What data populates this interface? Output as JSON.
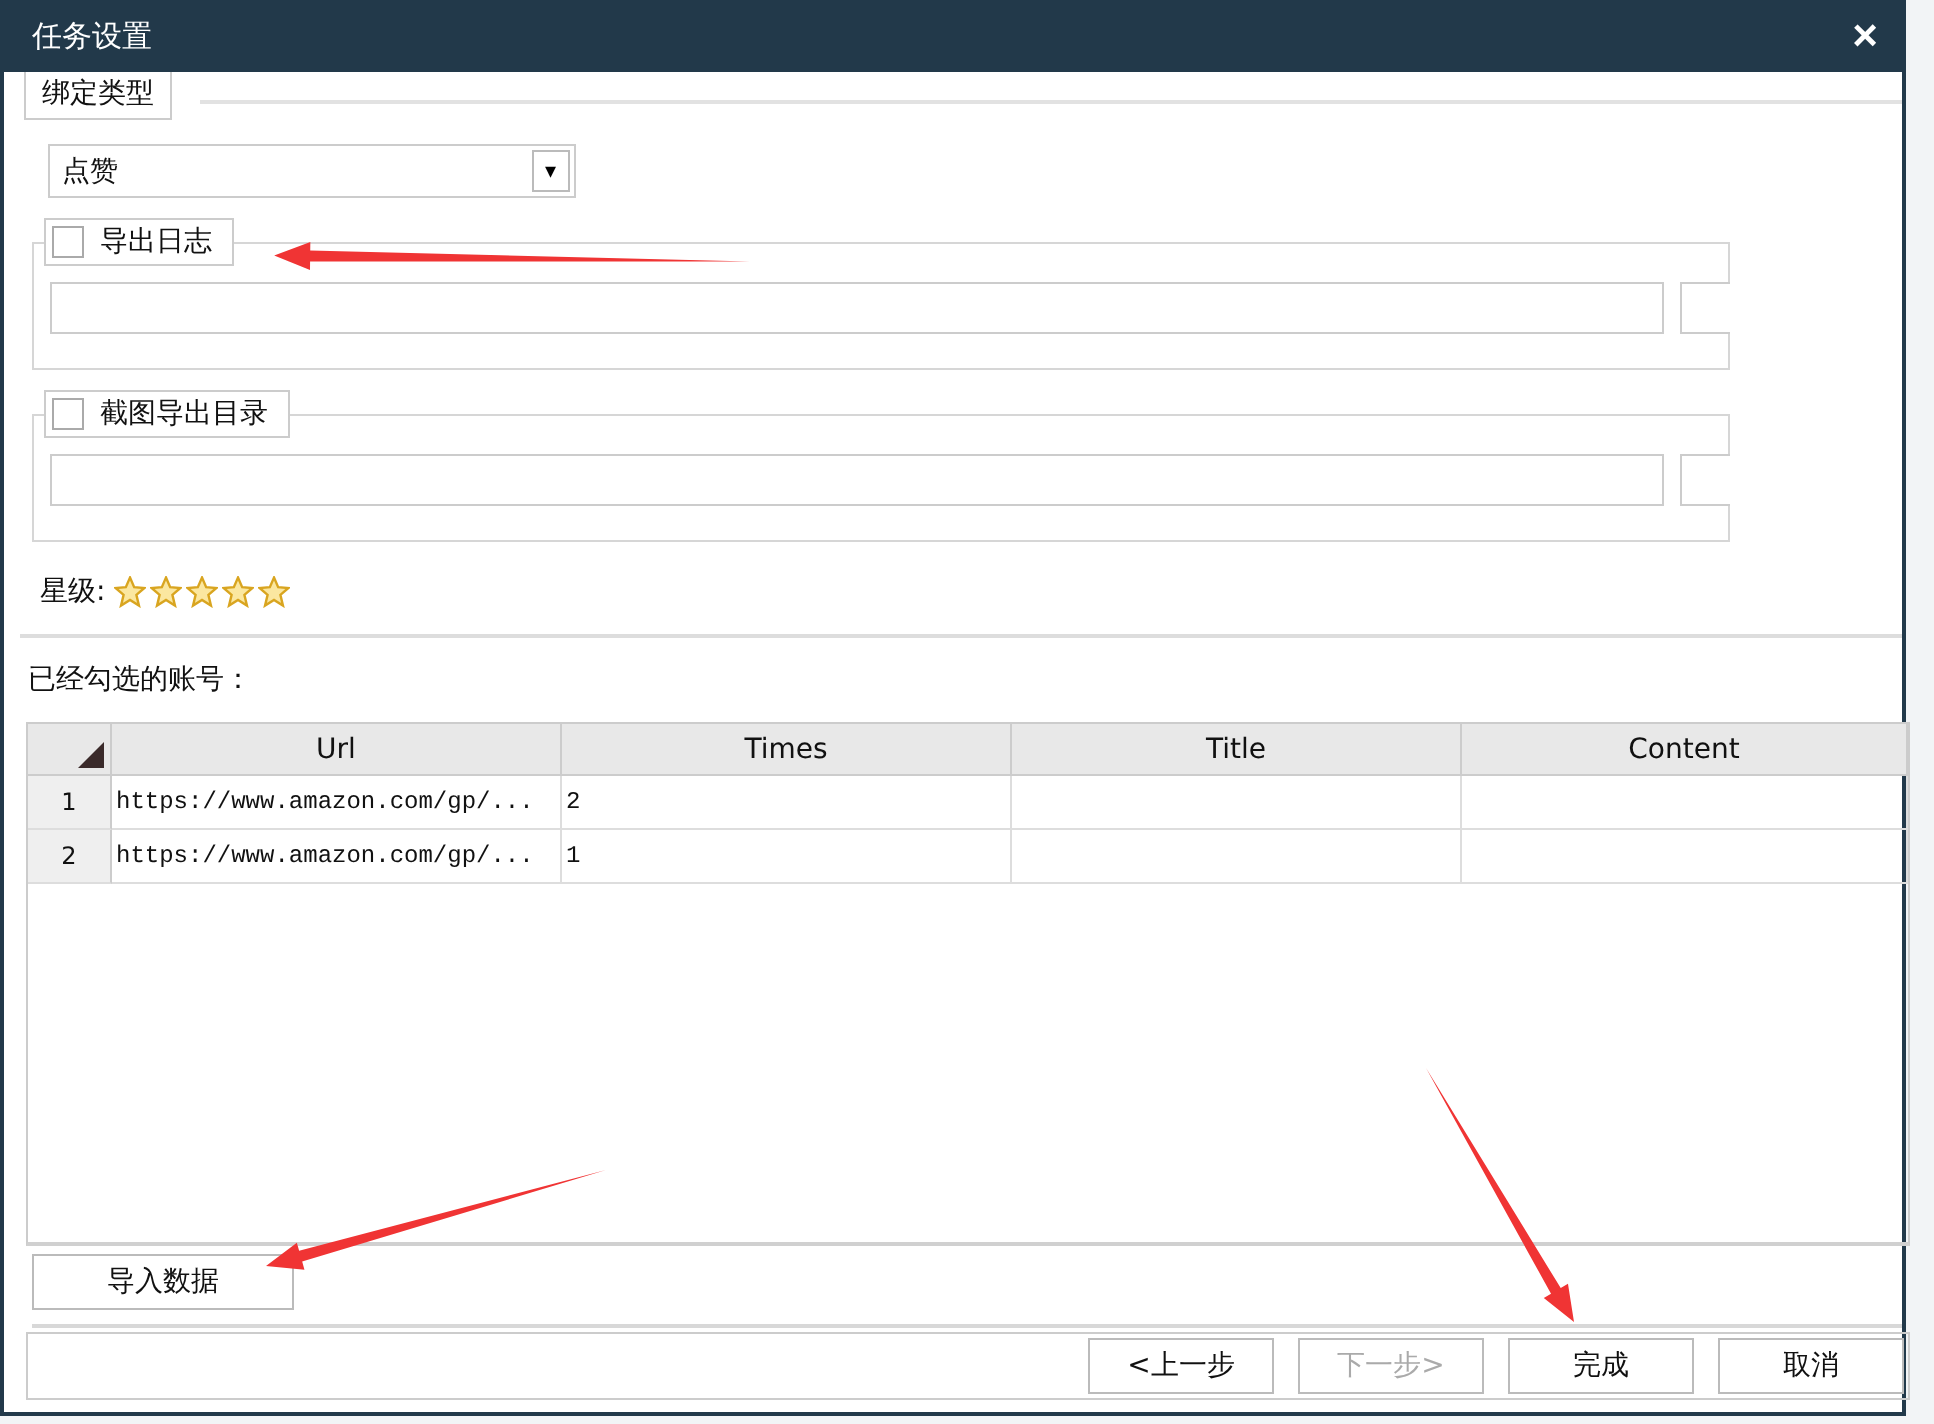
{
  "window": {
    "title": "任务设置",
    "close": "×"
  },
  "bind_type": {
    "label": "绑定类型",
    "value": "点赞",
    "arrow": "▾"
  },
  "export_log": {
    "label": "导出日志",
    "checked": false
  },
  "screenshot_dir": {
    "label": "截图导出目录",
    "checked": false
  },
  "rating": {
    "label": "星级:",
    "stars": 5
  },
  "accounts_label": "已经勾选的账号：",
  "table": {
    "columns": [
      "Url",
      "Times",
      "Title",
      "Content"
    ],
    "rows": [
      {
        "index": "1",
        "cells": [
          "https://www.amazon.com/gp/...",
          "2",
          "",
          ""
        ]
      },
      {
        "index": "2",
        "cells": [
          "https://www.amazon.com/gp/...",
          "1",
          "",
          ""
        ]
      }
    ]
  },
  "import_button": "导入数据",
  "buttons": [
    {
      "label": "<上一步",
      "disabled": false
    },
    {
      "label": "下一步>",
      "disabled": true
    },
    {
      "label": "完成",
      "disabled": false
    },
    {
      "label": "取消",
      "disabled": false
    }
  ]
}
